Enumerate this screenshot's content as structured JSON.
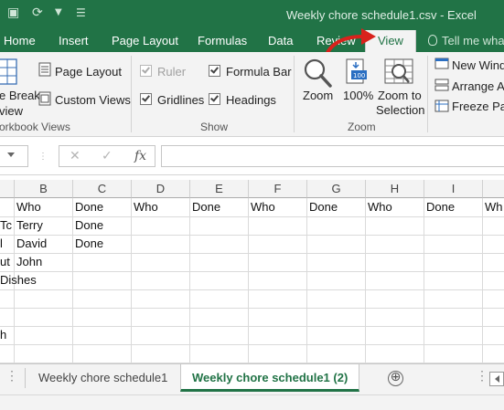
{
  "window": {
    "title": "Weekly chore schedule1.csv - Excel",
    "qat": {
      "redo_icon": "redo-icon",
      "customize_icon": "customize-qat-icon"
    }
  },
  "tabs": [
    {
      "label": "Home"
    },
    {
      "label": "Insert"
    },
    {
      "label": "Page Layout"
    },
    {
      "label": "Formulas"
    },
    {
      "label": "Data"
    },
    {
      "label": "Review"
    },
    {
      "label": "View",
      "active": true
    }
  ],
  "tell_me": "Tell me what",
  "ribbon": {
    "workbook_views": {
      "page_break": "e Break",
      "page_break_2": "view",
      "page_layout": "Page Layout",
      "custom_views": "Custom Views",
      "group_label": "orkbook Views"
    },
    "show": {
      "ruler": {
        "label": "Ruler",
        "checked": true,
        "enabled": false
      },
      "formula_bar": {
        "label": "Formula Bar",
        "checked": true
      },
      "gridlines": {
        "label": "Gridlines",
        "checked": true
      },
      "headings": {
        "label": "Headings",
        "checked": true
      },
      "group_label": "Show"
    },
    "zoom": {
      "zoom": "Zoom",
      "hundred": "100%",
      "zoom_to_selection": "Zoom to",
      "zoom_to_selection_2": "Selection",
      "group_label": "Zoom"
    },
    "window": {
      "new_window": "New Windo",
      "arrange_all": "Arrange Al",
      "freeze_panes": "Freeze Pan"
    }
  },
  "formula_bar": {
    "cancel_icon": "✕",
    "enter_icon": "✓",
    "fx_label": "fx",
    "value": ""
  },
  "grid": {
    "columns": [
      "B",
      "C",
      "D",
      "E",
      "F",
      "G",
      "H",
      "I"
    ],
    "rows": [
      [
        "Who",
        "Done",
        "Who",
        "Done",
        "Who",
        "Done",
        "Who",
        "Done",
        "Wh"
      ],
      [
        "Terry",
        "Done",
        "",
        "",
        "",
        "",
        "",
        "",
        ""
      ],
      [
        "David",
        "Done",
        "",
        "",
        "",
        "",
        "",
        "",
        ""
      ],
      [
        "John",
        "",
        "",
        "",
        "",
        "",
        "",
        "",
        ""
      ],
      [
        "Dishes",
        "",
        "",
        "",
        "",
        "",
        "",
        "",
        ""
      ]
    ],
    "col_a_fragments": [
      "Tc",
      "l",
      "ut",
      "",
      "",
      "",
      "h"
    ]
  },
  "sheets": [
    {
      "label": "Weekly chore schedule1",
      "active": false
    },
    {
      "label": "Weekly chore schedule1 (2)",
      "active": true
    }
  ],
  "add_sheet_icon": "⊕",
  "colors": {
    "excel_green": "#217346",
    "annotation_arrow": "#d9221c"
  }
}
